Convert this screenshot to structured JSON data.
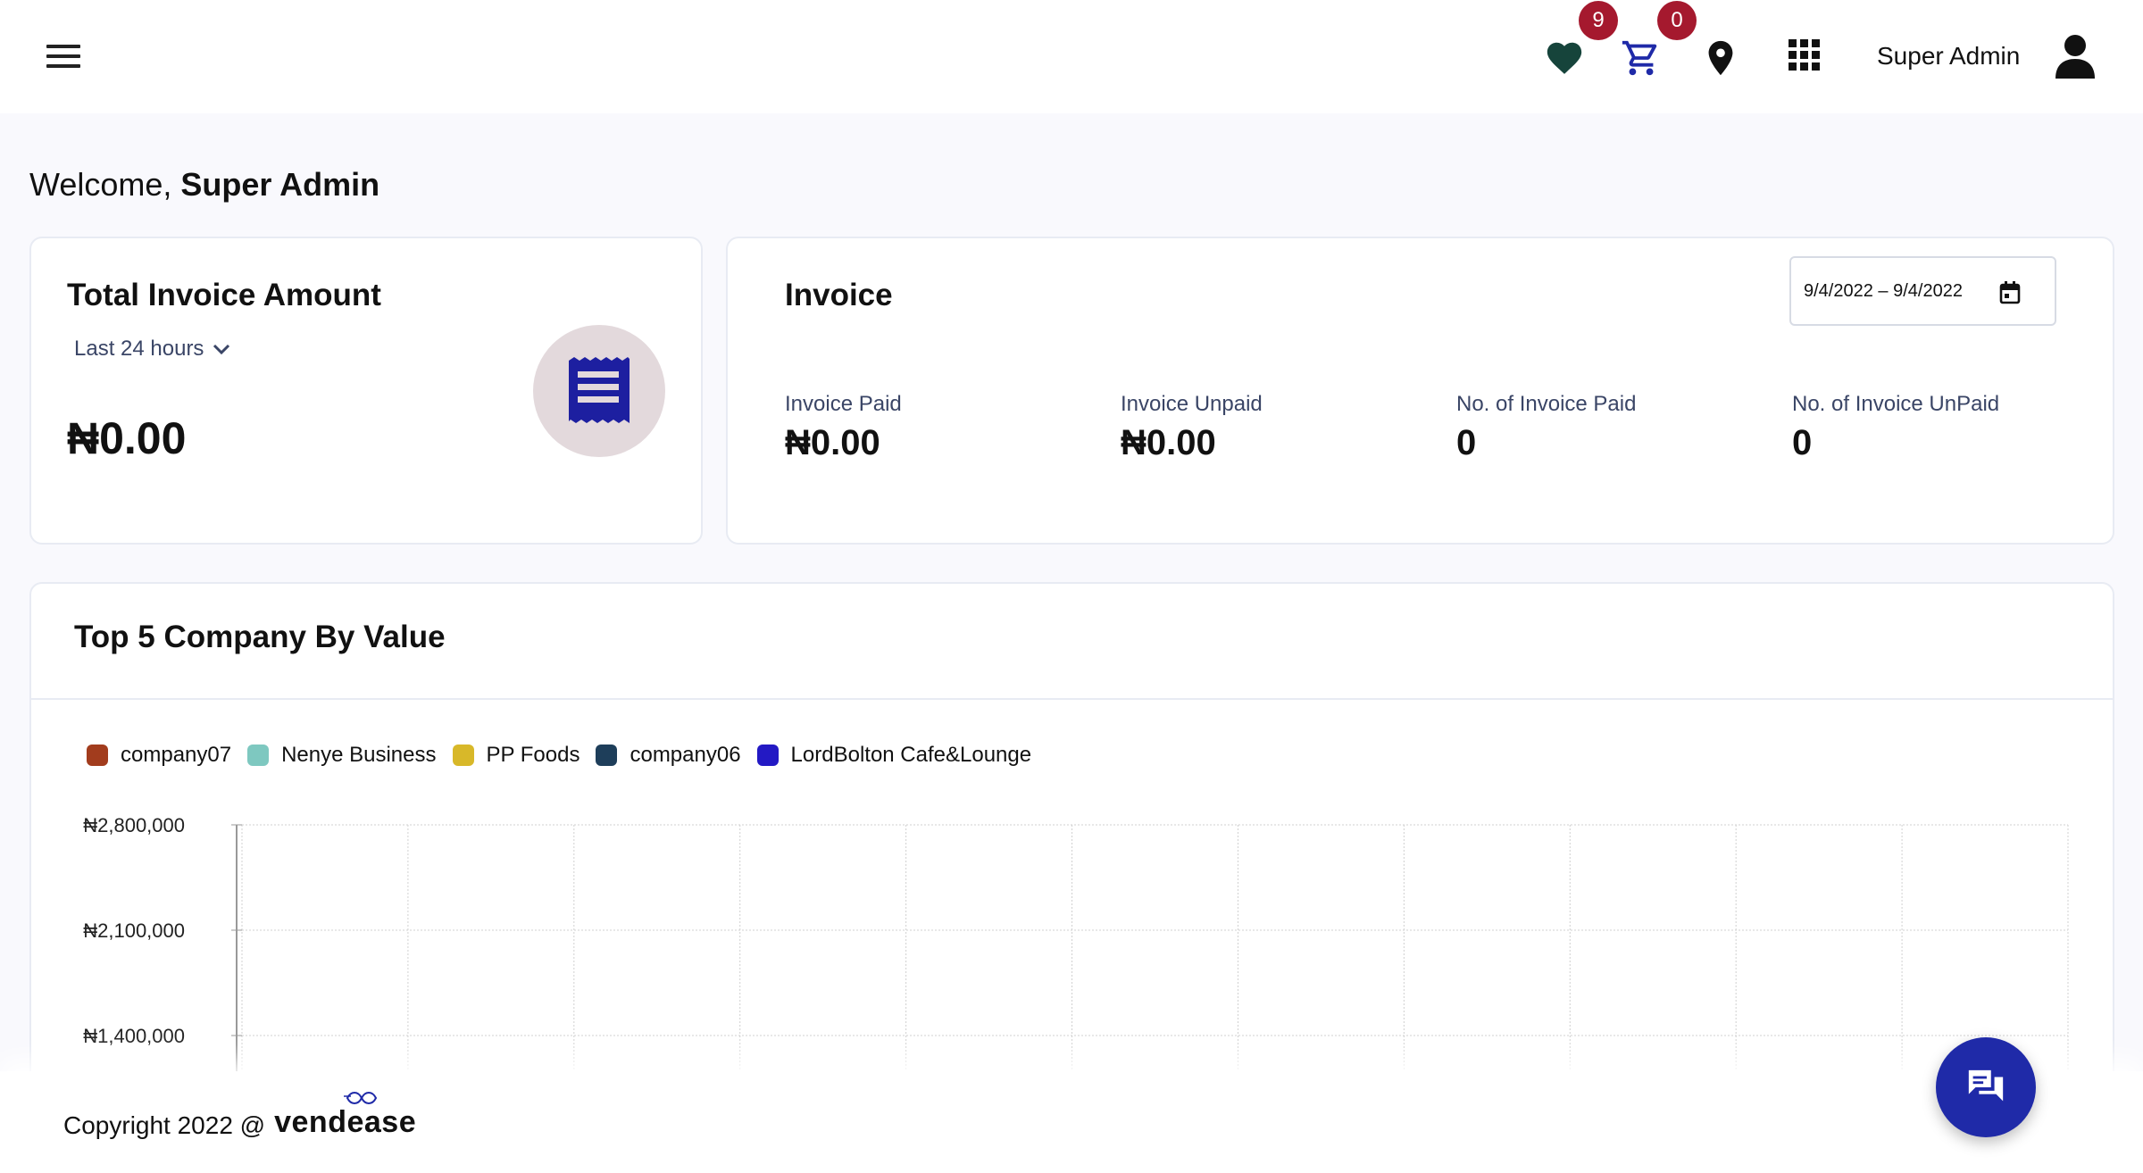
{
  "header": {
    "wishlist_count": "9",
    "cart_count": "0",
    "user_name": "Super Admin",
    "icons": [
      "menu-icon",
      "heart-icon",
      "cart-icon",
      "location-pin-icon",
      "apps-grid-icon",
      "user-avatar-icon"
    ]
  },
  "welcome": {
    "prefix": "Welcome,",
    "name": "Super Admin"
  },
  "total_invoice": {
    "title": "Total Invoice Amount",
    "period": "Last 24 hours",
    "amount": "₦0.00",
    "icon": "receipt-icon"
  },
  "invoice": {
    "title": "Invoice",
    "date_range": "9/4/2022 – 9/4/2022",
    "stats": [
      {
        "label": "Invoice Paid",
        "value": "₦0.00"
      },
      {
        "label": "Invoice Unpaid",
        "value": "₦0.00"
      },
      {
        "label": "No. of Invoice Paid",
        "value": "0"
      },
      {
        "label": "No. of Invoice UnPaid",
        "value": "0"
      }
    ]
  },
  "top5": {
    "title": "Top 5 Company By Value",
    "legend": [
      {
        "name": "company07",
        "color": "#a23c1d"
      },
      {
        "name": "Nenye Business",
        "color": "#7ec8c0"
      },
      {
        "name": "PP Foods",
        "color": "#d8b829"
      },
      {
        "name": "company06",
        "color": "#1e3e5a"
      },
      {
        "name": "LordBolton Cafe&Lounge",
        "color": "#2319c4"
      }
    ]
  },
  "chart_data": {
    "type": "bar",
    "title": "Top 5 Company By Value",
    "series": [
      {
        "name": "company07",
        "values": []
      },
      {
        "name": "Nenye Business",
        "values": []
      },
      {
        "name": "PP Foods",
        "values": []
      },
      {
        "name": "company06",
        "values": []
      },
      {
        "name": "LordBolton Cafe&Lounge",
        "values": []
      }
    ],
    "y_tick_labels": [
      "₦2,800,000",
      "₦2,100,000",
      "₦1,400,000"
    ],
    "y_ticks": [
      2800000,
      2100000,
      1400000
    ],
    "grid": true
  },
  "footer": {
    "copyright": "Copyright 2022 @",
    "brand": "vendease"
  },
  "colors": {
    "accent": "#1f2aa8",
    "badge": "#a5192e",
    "heart": "#16443b"
  }
}
